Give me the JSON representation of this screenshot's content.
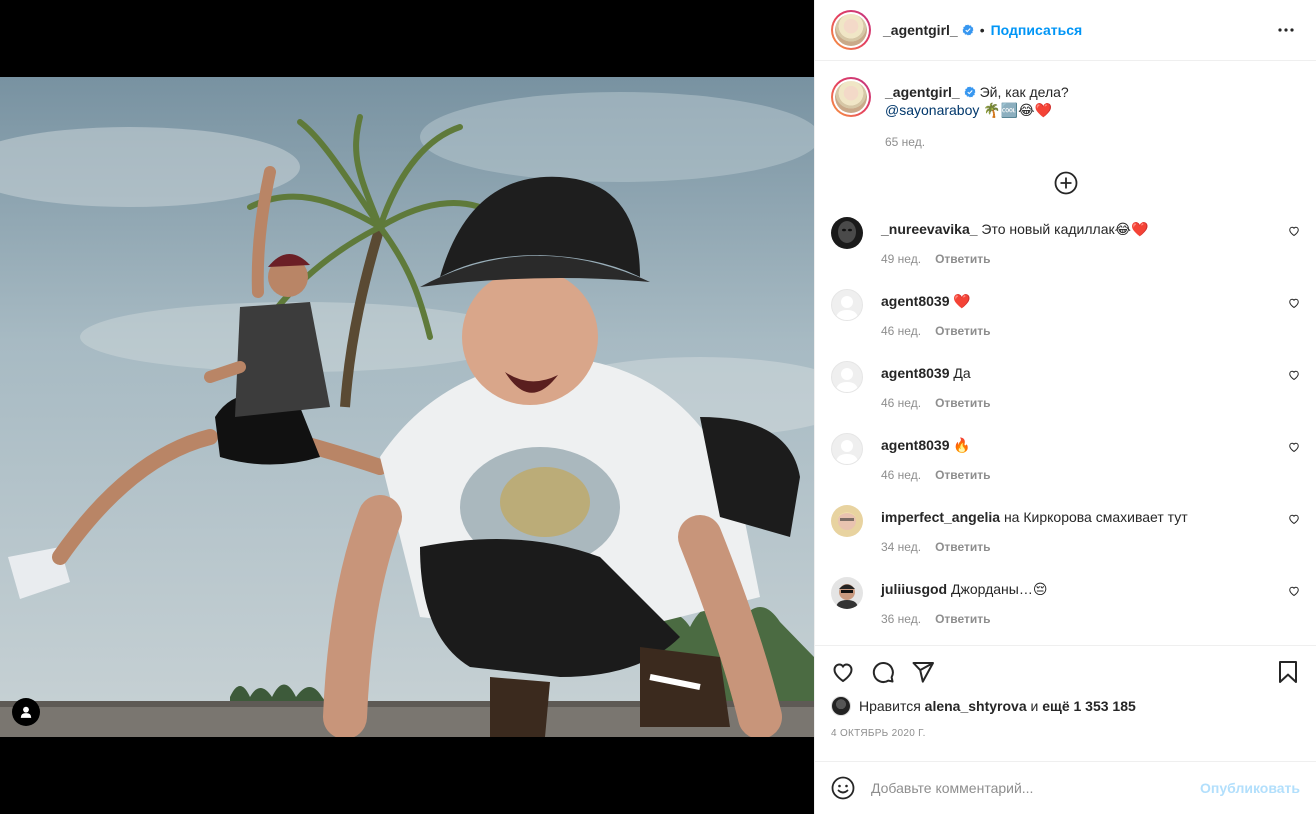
{
  "header": {
    "username": "_agentgirl_",
    "separator": "•",
    "follow_label": "Подписаться"
  },
  "caption": {
    "username": "_agentgirl_",
    "text": "Эй, как дела?",
    "mention": "@sayonaraboy",
    "emojis": "🌴🆒😂❤️",
    "time": "65 нед."
  },
  "comments": [
    {
      "username": "_nureevavika_",
      "text": "Это новый кадиллак😂❤️",
      "time": "49 нед.",
      "reply": "Ответить",
      "avatar": "dark"
    },
    {
      "username": "agent8039",
      "text": "❤️",
      "time": "46 нед.",
      "reply": "Ответить",
      "avatar": "empty"
    },
    {
      "username": "agent8039",
      "text": "Да",
      "time": "46 нед.",
      "reply": "Ответить",
      "avatar": "empty"
    },
    {
      "username": "agent8039",
      "text": "🔥",
      "time": "46 нед.",
      "reply": "Ответить",
      "avatar": "empty"
    },
    {
      "username": "imperfect_angelia",
      "text": "на Киркорова смахивает тут",
      "time": "34 нед.",
      "reply": "Ответить",
      "avatar": "blonde"
    },
    {
      "username": "juliiusgod",
      "text": "Джорданы…😔",
      "time": "36 нед.",
      "reply": "Ответить",
      "avatar": "person"
    }
  ],
  "likes": {
    "prefix": "Нравится",
    "user": "alena_shtyrova",
    "and": "и",
    "count": "ещё 1 353 185"
  },
  "date": "4 ОКТЯБРЬ 2020 Г.",
  "add_comment": {
    "placeholder": "Добавьте комментарий...",
    "publish_label": "Опубликовать"
  },
  "colors": {
    "link_blue": "#0095f6",
    "publish_disabled": "#b2dffc",
    "muted": "#8e8e8e",
    "like_red": "#ed4956"
  },
  "icons": [
    "user-tag-icon",
    "verified-icon",
    "more-options-icon",
    "load-more-icon",
    "heart-icon",
    "comment-icon",
    "share-icon",
    "bookmark-icon",
    "emoji-icon"
  ]
}
